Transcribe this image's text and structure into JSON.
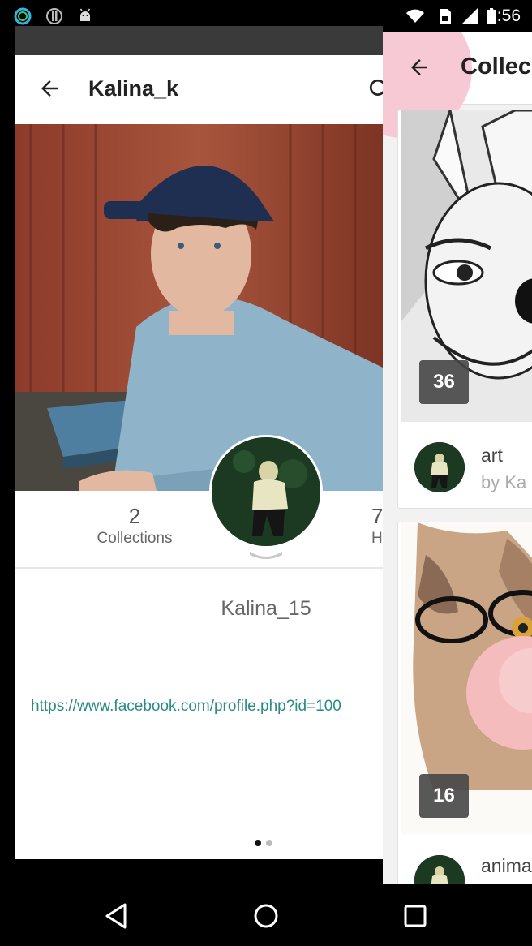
{
  "status_bar": {
    "time": "8:56",
    "left_icons": [
      "ring-notification-icon",
      "info-icon",
      "android-icon"
    ],
    "right_icons": [
      "wifi-icon",
      "sim-icon",
      "signal-icon",
      "battery-icon"
    ]
  },
  "profile": {
    "toolbar_title": "Kalina_k",
    "stats": [
      {
        "value": "2",
        "label": "Collections"
      },
      {
        "value": "7",
        "label": "H"
      }
    ],
    "display_name": "Kalina_15",
    "link": "https://www.facebook.com/profile.php?id=100",
    "pager": {
      "pages": 2,
      "active": 0
    }
  },
  "drawer": {
    "title": "Collec",
    "collections": [
      {
        "count": "36",
        "title": "art",
        "subtitle": "by Ka"
      },
      {
        "count": "16",
        "title": "anima",
        "subtitle": ""
      }
    ]
  },
  "nav_bar": {
    "buttons": [
      "back-icon",
      "home-icon",
      "recents-icon"
    ]
  },
  "colors": {
    "link": "#2a8a86",
    "ripple": "#f7c9d4",
    "badge": "#464646"
  }
}
